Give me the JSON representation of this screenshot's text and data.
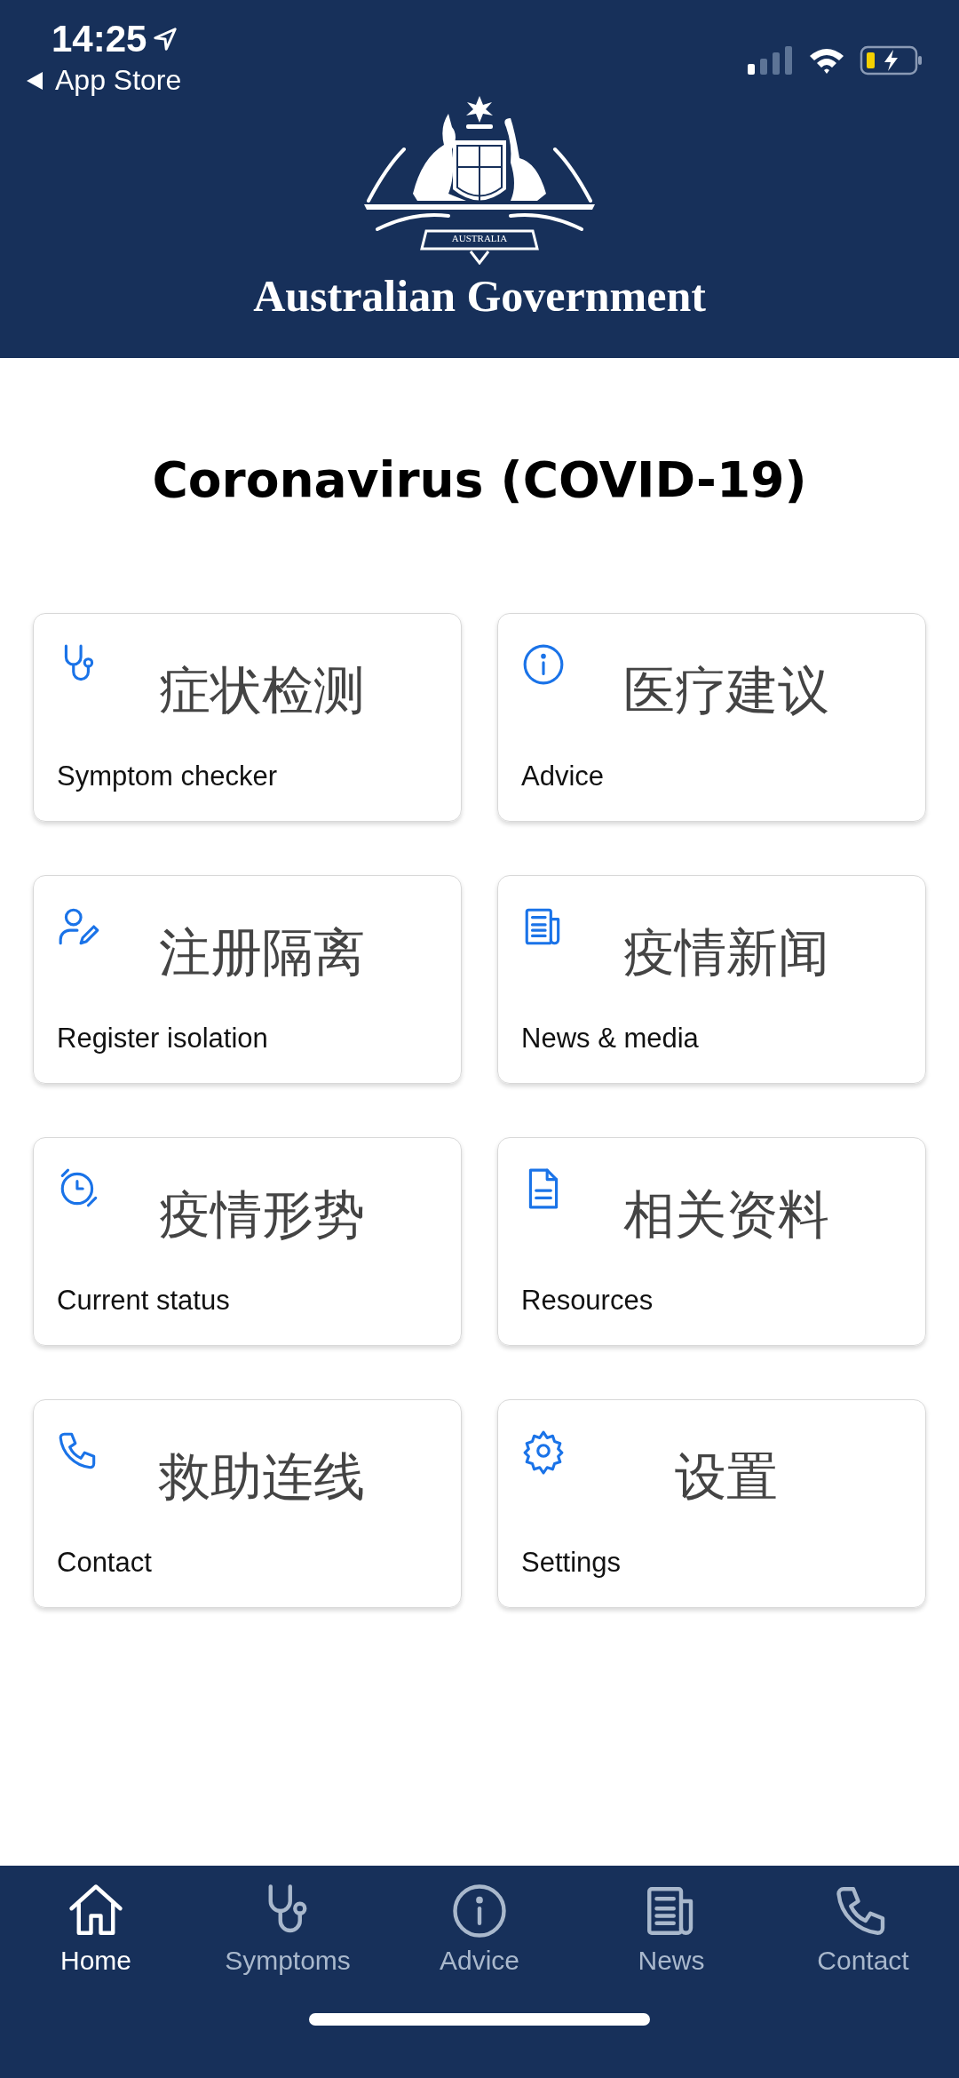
{
  "status_bar": {
    "time": "14:25",
    "back_label": "App Store"
  },
  "header": {
    "emblem_motto": "AUSTRALIA",
    "title": "Australian Government"
  },
  "page_title": "Coronavirus (COVID-19)",
  "cards": [
    {
      "kind": "stethoscope",
      "title_zh": "症状检测",
      "label": "Symptom checker"
    },
    {
      "kind": "info",
      "title_zh": "医疗建议",
      "label": "Advice"
    },
    {
      "kind": "person",
      "title_zh": "注册隔离",
      "label": "Register isolation"
    },
    {
      "kind": "news",
      "title_zh": "疫情新闻",
      "label": "News & media"
    },
    {
      "kind": "clock",
      "title_zh": "疫情形势",
      "label": "Current status"
    },
    {
      "kind": "document",
      "title_zh": "相关资料",
      "label": "Resources"
    },
    {
      "kind": "phone",
      "title_zh": "救助连线",
      "label": "Contact"
    },
    {
      "kind": "settings",
      "title_zh": "设置",
      "label": "Settings"
    }
  ],
  "tab_bar": [
    {
      "kind": "home",
      "label": "Home",
      "selected": true
    },
    {
      "kind": "stethoscope",
      "label": "Symptoms",
      "selected": false
    },
    {
      "kind": "info",
      "label": "Advice",
      "selected": false
    },
    {
      "kind": "news",
      "label": "News",
      "selected": false
    },
    {
      "kind": "phone",
      "label": "Contact",
      "selected": false
    }
  ]
}
